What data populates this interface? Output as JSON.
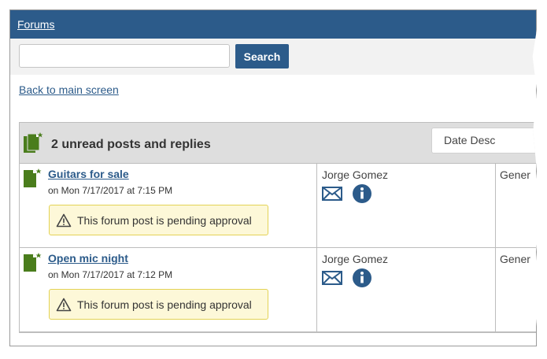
{
  "nav": {
    "breadcrumb": "Forums"
  },
  "search": {
    "value": "",
    "placeholder": "",
    "button_label": "Search"
  },
  "back_link": "Back to main screen",
  "list": {
    "header_title": "2 unread posts and replies",
    "sort_value": "Date Desc",
    "posts": [
      {
        "title": "Guitars for sale",
        "date": "on Mon 7/17/2017 at 7:15 PM",
        "status": "This forum post is pending approval",
        "author": "Jorge Gomez",
        "category": "Gener"
      },
      {
        "title": "Open mic night",
        "date": "on Mon 7/17/2017 at 7:12 PM",
        "status": "This forum post is pending approval",
        "author": "Jorge Gomez",
        "category": "Gener"
      }
    ]
  },
  "colors": {
    "brand": "#2c5b8a",
    "post_icon": "#4a7d1c",
    "pending_bg": "#fdf8d8",
    "pending_border": "#e3d255"
  },
  "icons": {
    "header": "forum-posts-icon",
    "post": "new-post-icon",
    "mail": "mail-icon",
    "info": "info-icon",
    "warning": "warning-icon"
  }
}
